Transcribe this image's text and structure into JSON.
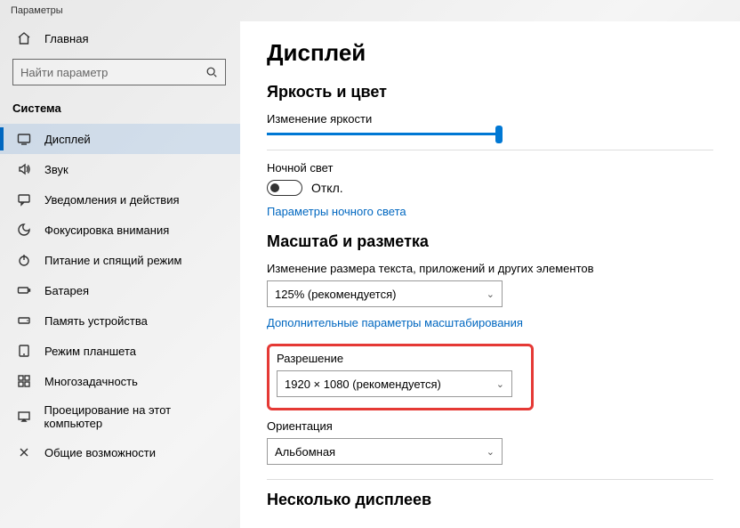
{
  "window": {
    "title": "Параметры"
  },
  "sidebar": {
    "home_label": "Главная",
    "search_placeholder": "Найти параметр",
    "section_label": "Система",
    "items": [
      {
        "label": "Дисплей",
        "icon": "display-icon",
        "active": true
      },
      {
        "label": "Звук",
        "icon": "sound-icon"
      },
      {
        "label": "Уведомления и действия",
        "icon": "notifications-icon"
      },
      {
        "label": "Фокусировка внимания",
        "icon": "focus-assist-icon"
      },
      {
        "label": "Питание и спящий режим",
        "icon": "power-icon"
      },
      {
        "label": "Батарея",
        "icon": "battery-icon"
      },
      {
        "label": "Память устройства",
        "icon": "storage-icon"
      },
      {
        "label": "Режим планшета",
        "icon": "tablet-mode-icon"
      },
      {
        "label": "Многозадачность",
        "icon": "multitasking-icon"
      },
      {
        "label": "Проецирование на этот компьютер",
        "icon": "projecting-icon"
      },
      {
        "label": "Общие возможности",
        "icon": "shared-experiences-icon"
      }
    ]
  },
  "main": {
    "title": "Дисплей",
    "brightness": {
      "heading": "Яркость и цвет",
      "slider_label": "Изменение яркости",
      "slider_value": 100
    },
    "night_light": {
      "label": "Ночной свет",
      "state": "Откл.",
      "settings_link": "Параметры ночного света"
    },
    "scale": {
      "heading": "Масштаб и разметка",
      "text_size_label": "Изменение размера текста, приложений и других элементов",
      "text_size_value": "125% (рекомендуется)",
      "advanced_link": "Дополнительные параметры масштабирования",
      "resolution_label": "Разрешение",
      "resolution_value": "1920 × 1080 (рекомендуется)",
      "orientation_label": "Ориентация",
      "orientation_value": "Альбомная"
    },
    "multi": {
      "heading": "Несколько дисплеев"
    }
  },
  "annotation": {
    "highlight_color": "#e53935",
    "arrow_color": "#1fa67a"
  }
}
